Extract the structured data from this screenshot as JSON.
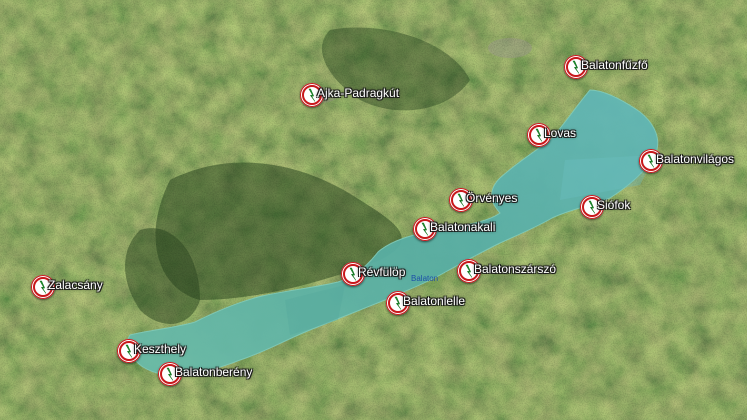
{
  "map": {
    "water_label": "Balaton",
    "marker_icon": "lightning-bolt-icon",
    "marker_color": "#c8171b",
    "lake_color": "#5fb3ad",
    "markers": [
      {
        "name": "Balatonfűzfő"
      },
      {
        "name": "Ajka-Padragkút"
      },
      {
        "name": "Lovas"
      },
      {
        "name": "Balatonvilágos"
      },
      {
        "name": "Örvényes"
      },
      {
        "name": "Siófok"
      },
      {
        "name": "Balatonakali"
      },
      {
        "name": "Révfülöp"
      },
      {
        "name": "Balatonszárszó"
      },
      {
        "name": "Balatonlelle"
      },
      {
        "name": "Zalacsány"
      },
      {
        "name": "Keszthely"
      },
      {
        "name": "Balatonberény"
      }
    ]
  }
}
